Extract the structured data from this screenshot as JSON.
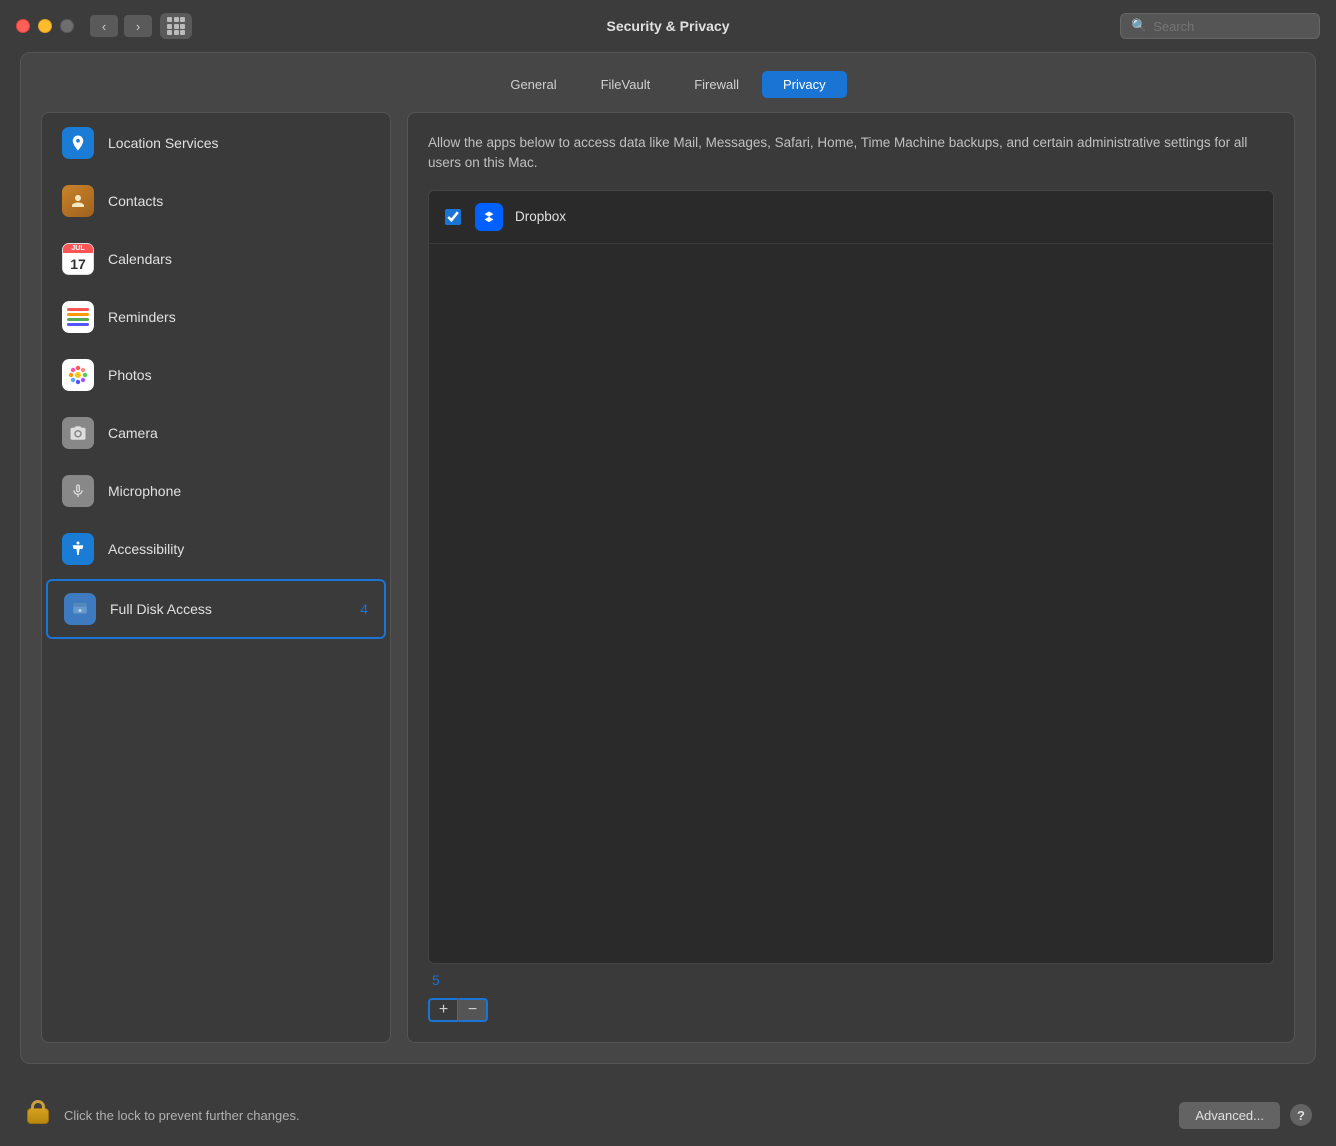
{
  "titlebar": {
    "title": "Security & Privacy",
    "search_placeholder": "Search"
  },
  "tabs": [
    {
      "id": "general",
      "label": "General",
      "active": false
    },
    {
      "id": "filevault",
      "label": "FileVault",
      "active": false
    },
    {
      "id": "firewall",
      "label": "Firewall",
      "active": false
    },
    {
      "id": "privacy",
      "label": "Privacy",
      "active": true
    }
  ],
  "sidebar": {
    "items": [
      {
        "id": "location-services",
        "label": "Location Services",
        "iconType": "location",
        "badge": ""
      },
      {
        "id": "contacts",
        "label": "Contacts",
        "iconType": "contacts",
        "badge": ""
      },
      {
        "id": "calendars",
        "label": "Calendars",
        "iconType": "calendars",
        "badge": ""
      },
      {
        "id": "reminders",
        "label": "Reminders",
        "iconType": "reminders",
        "badge": ""
      },
      {
        "id": "photos",
        "label": "Photos",
        "iconType": "photos",
        "badge": ""
      },
      {
        "id": "camera",
        "label": "Camera",
        "iconType": "camera",
        "badge": ""
      },
      {
        "id": "microphone",
        "label": "Microphone",
        "iconType": "microphone",
        "badge": ""
      },
      {
        "id": "accessibility",
        "label": "Accessibility",
        "iconType": "accessibility",
        "badge": ""
      },
      {
        "id": "full-disk-access",
        "label": "Full Disk Access",
        "iconType": "fullDisk",
        "badge": "4",
        "selected": true
      }
    ]
  },
  "right_panel": {
    "description": "Allow the apps below to access data like Mail, Messages, Safari, Home, Time Machine backups, and certain administrative settings for all users on this Mac.",
    "scroll_indicator": "5",
    "apps": [
      {
        "id": "dropbox",
        "name": "Dropbox",
        "checked": true
      }
    ],
    "add_label": "+",
    "remove_label": "−"
  },
  "bottom_bar": {
    "lock_text": "Click the lock to prevent further changes.",
    "advanced_label": "Advanced...",
    "help_label": "?"
  }
}
